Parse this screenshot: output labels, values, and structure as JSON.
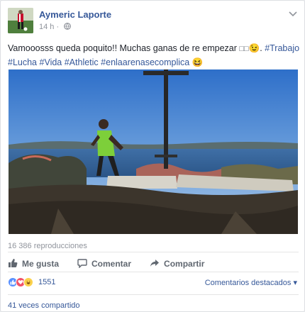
{
  "post": {
    "author": "Aymeric Laporte",
    "timestamp": "14 h",
    "separator": "·",
    "privacy_icon": "globe-icon",
    "text_plain": "Vamooosss queda poquito!! Muchas ganas de re empezar ",
    "text_symbols": "□□",
    "text_emoji": "😉",
    "hashtags_line1": "#Trabajo",
    "hashtags_line2": [
      "#Lucha",
      "#Vida",
      "#Athletic",
      "#enlaarenasecomplica"
    ],
    "text_end_emoji": "😆",
    "video_views": "16 386 reproducciones"
  },
  "actions": {
    "like_label": "Me gusta",
    "comment_label": "Comentar",
    "share_label": "Compartir"
  },
  "reactions": {
    "count": "1551",
    "types": [
      "like",
      "love",
      "haha"
    ],
    "top_comments_label": "Comentarios destacados",
    "top_comments_chevron": "▾",
    "shares_label": "41 veces compartido"
  },
  "colors": {
    "link": "#365899",
    "muted": "#90949c",
    "like_blue": "#5890ff",
    "love_red": "#f25268",
    "haha_yellow": "#fbd14b"
  }
}
